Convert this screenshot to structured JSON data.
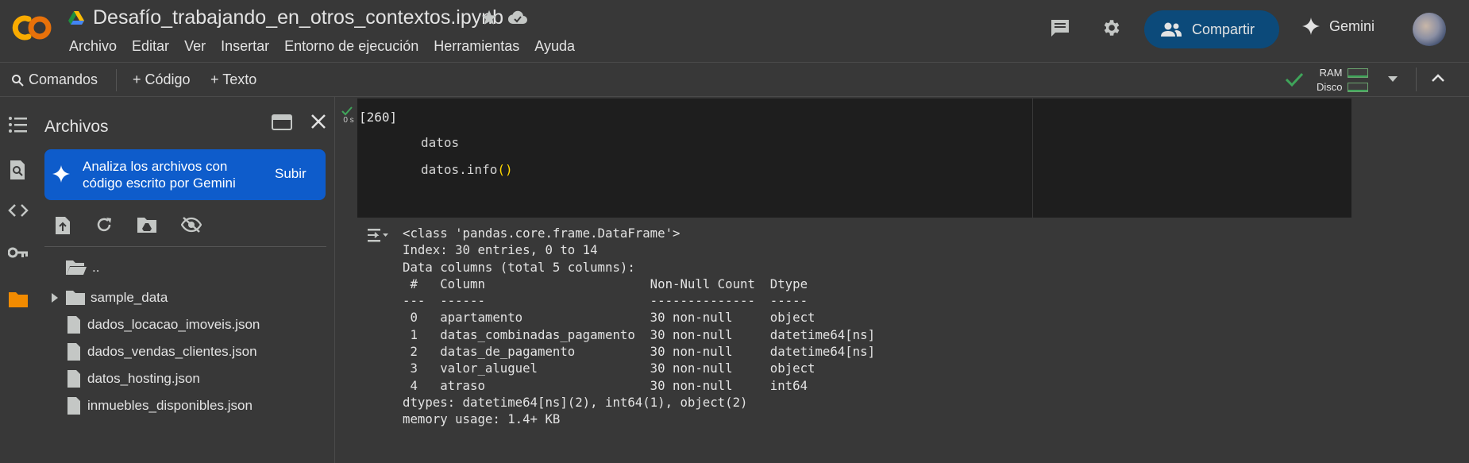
{
  "header": {
    "logo_text": "CO",
    "notebook_title": "Desafío_trabajando_en_otros_contextos.ipynb",
    "menu": [
      "Archivo",
      "Editar",
      "Ver",
      "Insertar",
      "Entorno de ejecución",
      "Herramientas",
      "Ayuda"
    ],
    "share_label": "Compartir",
    "gemini_label": "Gemini",
    "colors": {
      "share_bg": "#0c4a7a",
      "logo_orange": "#f9ab00",
      "logo_dark_orange": "#e8710a"
    }
  },
  "toolbar": {
    "commands_label": "Comandos",
    "add_code_label": "+ Código",
    "add_text_label": "+ Texto",
    "ram_label": "RAM",
    "disk_label": "Disco",
    "status_color": "#3fa55a"
  },
  "rail": {
    "icons": [
      "toc-icon",
      "find-replace-icon",
      "code-snippets-icon",
      "secrets-key-icon",
      "files-folder-icon"
    ]
  },
  "files_panel": {
    "title": "Archivos",
    "banner_text": "Analiza los archivos con código escrito por Gemini",
    "banner_button": "Subir",
    "tree": [
      {
        "label": "..",
        "type": "folder-up"
      },
      {
        "label": "sample_data",
        "type": "folder"
      },
      {
        "label": "dados_locacao_imoveis.json",
        "type": "file"
      },
      {
        "label": "dados_vendas_clientes.json",
        "type": "file"
      },
      {
        "label": "datos_hosting.json",
        "type": "file"
      },
      {
        "label": "inmuebles_disponibles.json",
        "type": "file"
      }
    ]
  },
  "cell": {
    "exec_status": "0 s",
    "exec_count": "[260]",
    "code_line1": "datos",
    "code_line2_pre": "datos.info",
    "code_line2_paren": "()",
    "output_lines": [
      "<class 'pandas.core.frame.DataFrame'>",
      "Index: 30 entries, 0 to 14",
      "Data columns (total 5 columns):",
      " #   Column                      Non-Null Count  Dtype         ",
      "---  ------                      --------------  -----         ",
      " 0   apartamento                 30 non-null     object        ",
      " 1   datas_combinadas_pagamento  30 non-null     datetime64[ns]",
      " 2   datas_de_pagamento          30 non-null     datetime64[ns]",
      " 3   valor_aluguel               30 non-null     object        ",
      " 4   atraso                      30 non-null     int64         ",
      "dtypes: datetime64[ns](2), int64(1), object(2)",
      "memory usage: 1.4+ KB"
    ]
  }
}
